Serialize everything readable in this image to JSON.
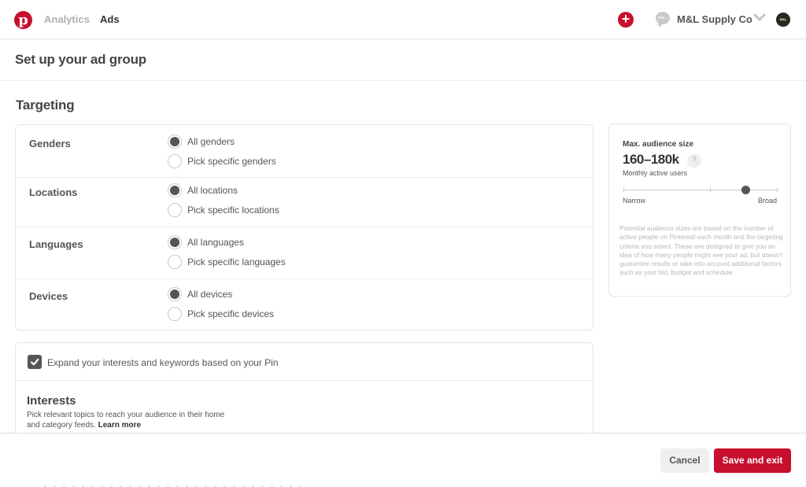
{
  "topbar": {
    "logo_glyph": "p",
    "nav": [
      {
        "label": "Analytics",
        "active": false
      },
      {
        "label": "Ads",
        "active": true
      }
    ],
    "add_glyph": "+",
    "messages_glyph": "•••",
    "account_name": "M&L Supply Co",
    "avatar_text": "M&L"
  },
  "page": {
    "title": "Set up your ad group"
  },
  "targeting": {
    "title": "Targeting",
    "rows": [
      {
        "label": "Genders",
        "options": [
          {
            "label": "All genders",
            "checked": true
          },
          {
            "label": "Pick specific genders",
            "checked": false
          }
        ]
      },
      {
        "label": "Locations",
        "options": [
          {
            "label": "All locations",
            "checked": true
          },
          {
            "label": "Pick specific locations",
            "checked": false
          }
        ]
      },
      {
        "label": "Languages",
        "options": [
          {
            "label": "All languages",
            "checked": true
          },
          {
            "label": "Pick specific languages",
            "checked": false
          }
        ]
      },
      {
        "label": "Devices",
        "options": [
          {
            "label": "All devices",
            "checked": true
          },
          {
            "label": "Pick specific devices",
            "checked": false
          }
        ]
      }
    ]
  },
  "interests": {
    "expand_label": "Expand your interests and keywords based on your Pin",
    "expand_checked": true,
    "title": "Interests",
    "description": "Pick relevant topics to reach your audience in their home and category feeds.",
    "learn_more": "Learn more"
  },
  "audience": {
    "title": "Max. audience size",
    "value": "160–180k",
    "help_glyph": "?",
    "subtitle": "Monthly active users",
    "slider_position": 0.79,
    "narrow_label": "Narrow",
    "broad_label": "Broad",
    "note": "Potential audience sizes are based on the number of active people on Pinterest each month and the targeting criteria you select. These are designed to give you an idea of how many people might see your ad, but doesn't guarantee results or take into account additional factors such as your bid, budget and schedule."
  },
  "footer": {
    "cancel_label": "Cancel",
    "save_label": "Save and exit"
  },
  "colors": {
    "brand_red": "#c8102e",
    "text_dark": "#333333",
    "text_muted": "#b0b0b0"
  }
}
